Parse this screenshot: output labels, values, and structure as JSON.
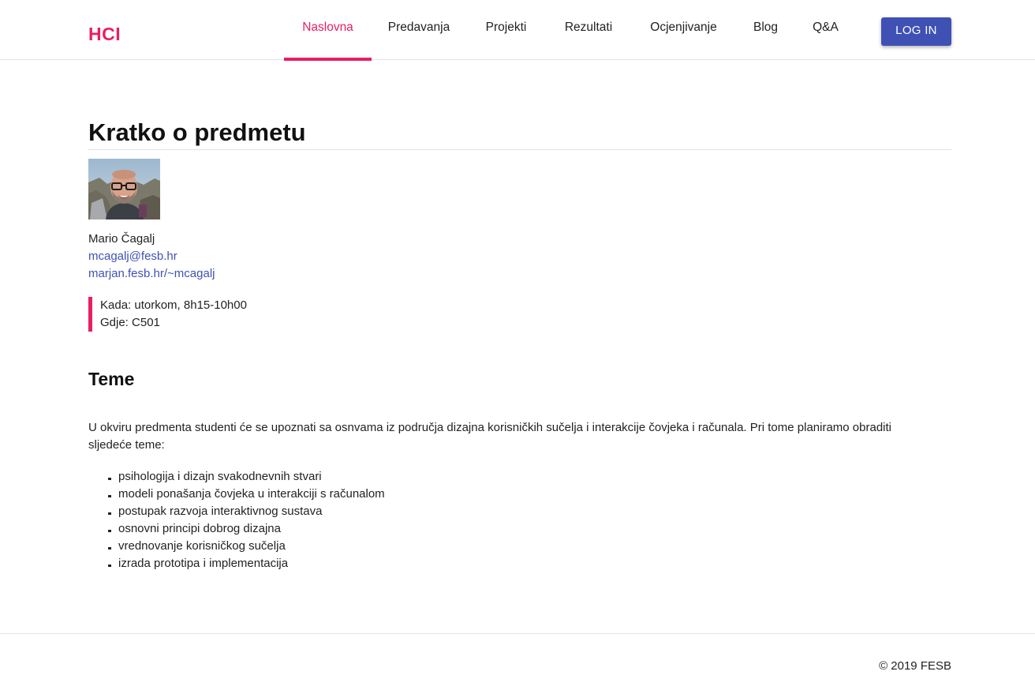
{
  "header": {
    "brand": "HCI",
    "nav": [
      {
        "label": "Naslovna",
        "active": true
      },
      {
        "label": "Predavanja",
        "active": false
      },
      {
        "label": "Projekti",
        "active": false
      },
      {
        "label": "Rezultati",
        "active": false
      },
      {
        "label": "Ocjenjivanje",
        "active": false
      },
      {
        "label": "Blog",
        "active": false
      },
      {
        "label": "Q&A",
        "active": false
      }
    ],
    "login_label": "LOG IN"
  },
  "colors": {
    "accent": "#e91e63",
    "primary": "#3f51b5"
  },
  "main": {
    "title": "Kratko o predmetu",
    "lecturer": {
      "name": "Mario Čagalj",
      "email": "mcagalj@fesb.hr",
      "website": "marjan.fesb.hr/~mcagalj"
    },
    "info": {
      "when": "Kada: utorkom, 8h15-10h00",
      "where": "Gdje: C501"
    },
    "topics_title": "Teme",
    "intro": "U okviru predmenta studenti će se upoznati sa osnvama iz područja dizajna korisničkih sučelja i interakcije čovjeka i računala. Pri tome planiramo obraditi sljedeće teme:",
    "topics": [
      "psihologija i dizajn svakodnevnih stvari",
      "modeli ponašanja čovjeka u interakciji s računalom",
      "postupak razvoja interaktivnog sustava",
      "osnovni principi dobrog dizajna",
      "vrednovanje korisničkog sučelja",
      "izrada prototipa i implementacija"
    ]
  },
  "footer": {
    "copyright": "© 2019 FESB"
  }
}
